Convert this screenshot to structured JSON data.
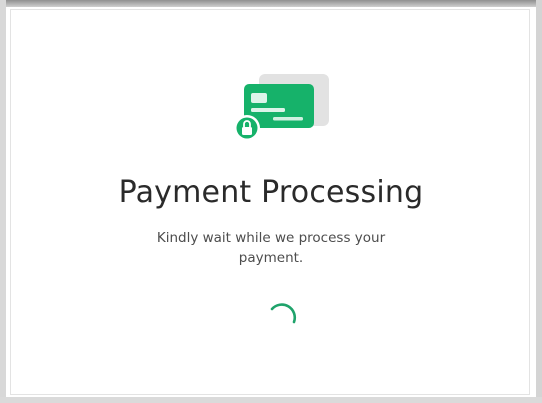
{
  "dialog": {
    "title": "Payment Processing",
    "message": "Kindly wait while we process your payment.",
    "illustration_icon": "credit-card-lock-icon",
    "spinner_icon": "loading-spinner-icon"
  },
  "colors": {
    "accent_green": "#16b26a",
    "card_shadow": "#e2e2e2",
    "title_text": "#2a2a2a",
    "body_text": "#4d4d4d",
    "spinner": "#1fa36b"
  }
}
